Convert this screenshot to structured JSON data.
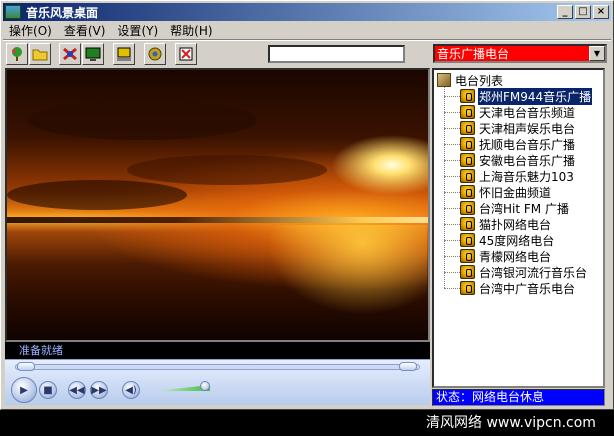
{
  "window": {
    "title": "音乐风景桌面"
  },
  "caption_buttons": {
    "minimize": "_",
    "maximize": "□",
    "close": "×"
  },
  "menu": [
    {
      "label": "操作",
      "mnemonic": "(O)"
    },
    {
      "label": "查看",
      "mnemonic": "(V)"
    },
    {
      "label": "设置",
      "mnemonic": "(Y)"
    },
    {
      "label": "帮助",
      "mnemonic": "(H)"
    }
  ],
  "toolbar": {
    "search_value": "",
    "station_category": "音乐广播电台"
  },
  "video": {
    "status_text": "准备就绪"
  },
  "player": {
    "seek_fraction": 0.0,
    "volume_fraction": 0.9,
    "play_icon": "play-icon",
    "stop_icon": "stop-icon",
    "prev_icon": "previous-icon",
    "next_icon": "next-icon",
    "volume_icon": "speaker-icon"
  },
  "tree": {
    "root_label": "电台列表",
    "items": [
      {
        "label": "郑州FM944音乐广播",
        "selected": true
      },
      {
        "label": "天津电台音乐频道"
      },
      {
        "label": "天津相声娱乐电台"
      },
      {
        "label": "抚顺电台音乐广播"
      },
      {
        "label": "安徽电台音乐广播"
      },
      {
        "label": "上海音乐魅力103"
      },
      {
        "label": "怀旧金曲频道"
      },
      {
        "label": "台湾Hit FM 广播"
      },
      {
        "label": "猫扑网络电台"
      },
      {
        "label": "45度网络电台"
      },
      {
        "label": "青檬网络电台"
      },
      {
        "label": "台湾银河流行音乐台"
      },
      {
        "label": "台湾中广音乐电台"
      }
    ]
  },
  "status_bar": {
    "text": "状态：网络电台休息"
  },
  "watermark": {
    "text": "清风网络 www.vipcn.com"
  },
  "colors": {
    "title_bar": "#0a246a",
    "station_select": "#ff0000",
    "status_bar": "#0000ff",
    "selection": "#0a246a"
  }
}
